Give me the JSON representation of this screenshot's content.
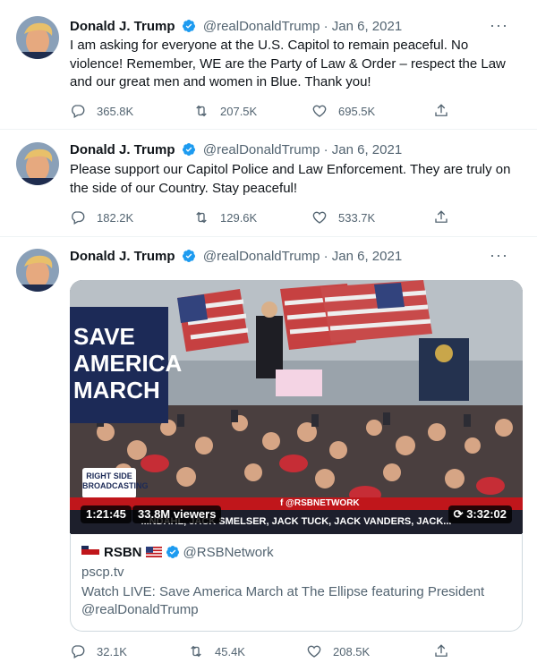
{
  "author": {
    "name": "Donald J. Trump",
    "handle": "@realDonaldTrump",
    "separator": "·",
    "date": "Jan 6, 2021"
  },
  "more_label": "···",
  "tweets": [
    {
      "text": "I am asking for everyone at the U.S. Capitol to remain peaceful. No violence! Remember, WE are the Party of Law & Order – respect the Law and our great men and women in Blue. Thank you!",
      "replies": "365.8K",
      "retweets": "207.5K",
      "likes": "695.5K"
    },
    {
      "text": "Please support our Capitol Police and Law Enforcement. They are truly on the side of our Country. Stay peaceful!",
      "replies": "182.2K",
      "retweets": "129.6K",
      "likes": "533.7K"
    },
    {
      "text": "",
      "replies": "32.1K",
      "retweets": "45.4K",
      "likes": "208.5K"
    }
  ],
  "media": {
    "banner_text": "SAVE AMERICA MARCH",
    "right_side_logo": "RIGHT SIDE BROADCASTING",
    "ticker_label": "f @RSBNETWORK",
    "ticker_text": "...NDAHL, JACK SMELSER, JACK TUCK, JACK VANDERS, JACK...",
    "elapsed": "1:21:45",
    "viewers": "33.8M viewers",
    "duration": "3:32:02"
  },
  "card": {
    "account_name": "RSBN",
    "account_handle": "@RSBNetwork",
    "domain": "pscp.tv",
    "description": "Watch LIVE: Save America March at The Ellipse featuring President @realDonaldTrump"
  },
  "colors": {
    "text_primary": "#0f1419",
    "text_secondary": "#536471",
    "verified_blue": "#1d9bf0",
    "divider": "#eff3f4",
    "card_border": "#cfd9de"
  }
}
